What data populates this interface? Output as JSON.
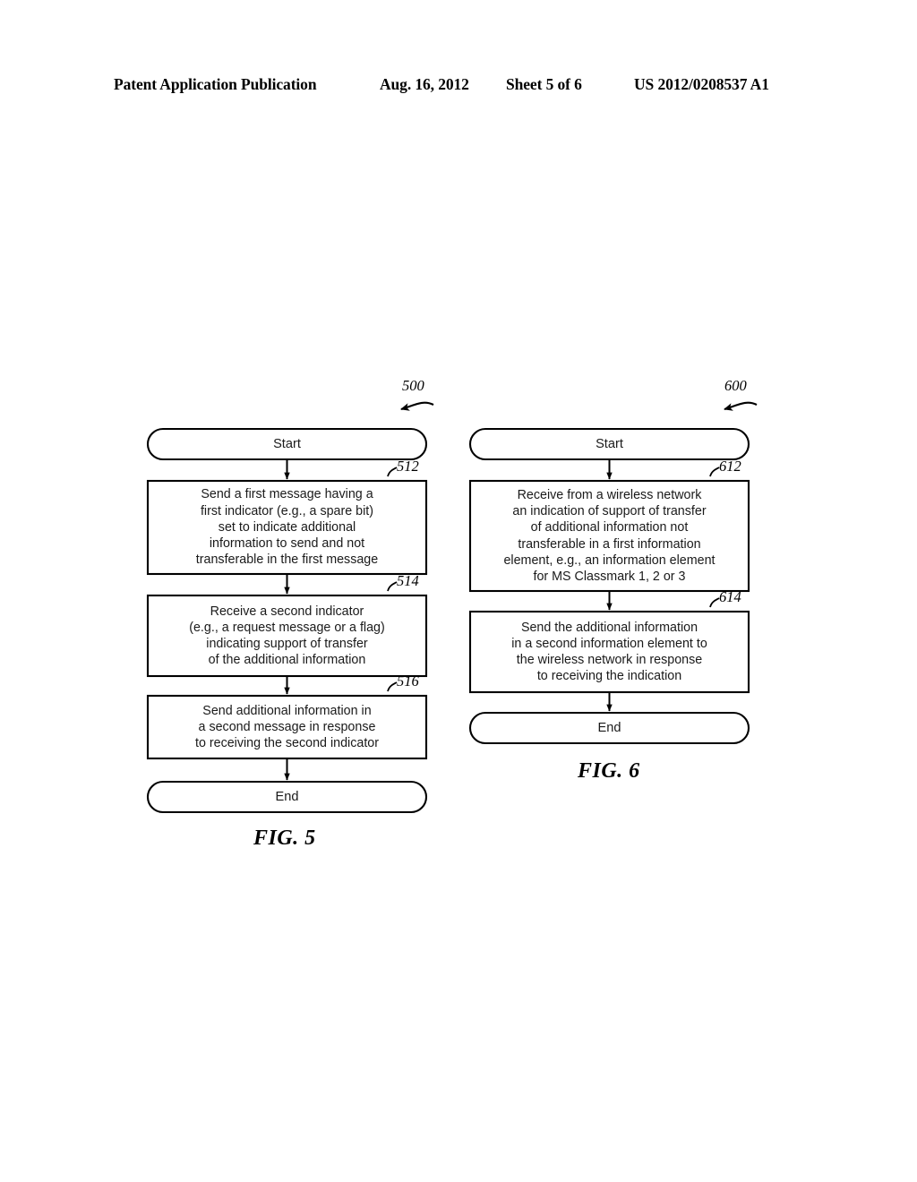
{
  "header": {
    "publication": "Patent Application Publication",
    "date": "Aug. 16, 2012",
    "sheet": "Sheet 5 of 6",
    "patent_number": "US 2012/0208537 A1"
  },
  "figures": [
    {
      "id": "fig5",
      "caption": "FIG. 5",
      "flow_ref": "500",
      "nodes": [
        {
          "id": "fig5-start",
          "type": "terminal",
          "label": "Start",
          "ref": null
        },
        {
          "id": "fig5-512",
          "type": "process",
          "ref": "512",
          "label": "Send a first message having a\nfirst indicator (e.g., a spare bit)\nset to indicate additional\ninformation to send and not\ntransferable in the first message"
        },
        {
          "id": "fig5-514",
          "type": "process",
          "ref": "514",
          "label": "Receive a second indicator\n(e.g., a request message or a flag)\nindicating support of transfer\nof the additional information"
        },
        {
          "id": "fig5-516",
          "type": "process",
          "ref": "516",
          "label": "Send additional information in\na second message in response\nto receiving the second indicator"
        },
        {
          "id": "fig5-end",
          "type": "terminal",
          "label": "End",
          "ref": null
        }
      ]
    },
    {
      "id": "fig6",
      "caption": "FIG. 6",
      "flow_ref": "600",
      "nodes": [
        {
          "id": "fig6-start",
          "type": "terminal",
          "label": "Start",
          "ref": null
        },
        {
          "id": "fig6-612",
          "type": "process",
          "ref": "612",
          "label": "Receive from a wireless network\nan indication of support of transfer\nof additional information not\ntransferable in a first information\nelement, e.g., an information element\nfor MS Classmark 1, 2 or 3"
        },
        {
          "id": "fig6-614",
          "type": "process",
          "ref": "614",
          "label": "Send the additional information\nin a second information element to\nthe wireless network in response\nto receiving the indication"
        },
        {
          "id": "fig6-end",
          "type": "terminal",
          "label": "End",
          "ref": null
        }
      ]
    }
  ],
  "colors": {
    "ink": "#000000",
    "paper": "#ffffff",
    "text": "#1a1a1a"
  }
}
